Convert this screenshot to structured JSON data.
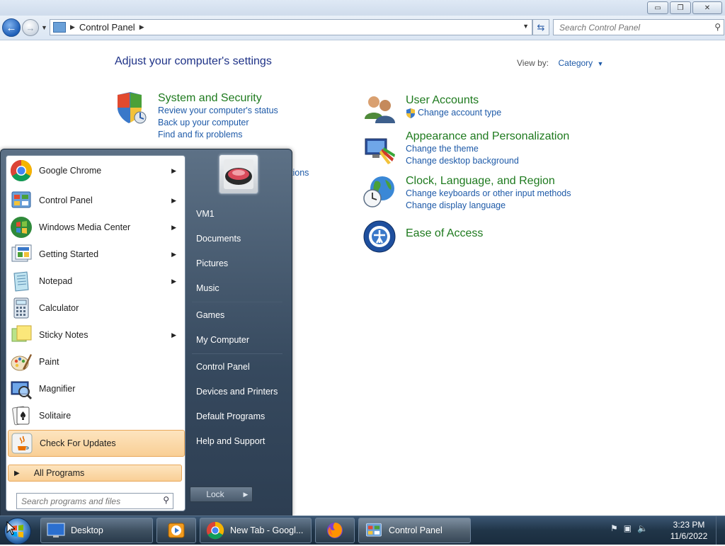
{
  "window": {
    "address": "Control Panel",
    "search_placeholder": "Search Control Panel",
    "minimize_label": "▭",
    "restore_label": "❐",
    "close_label": "✕"
  },
  "control_panel": {
    "heading": "Adjust your computer's settings",
    "view_by_label": "View by:",
    "view_by_value": "Category",
    "categories": [
      {
        "title": "System and Security",
        "links": [
          "Review your computer's status",
          "Back up your computer",
          "Find and fix problems"
        ]
      },
      {
        "title": "User Accounts",
        "links": [
          "Change account type"
        ]
      },
      {
        "title": "Appearance and Personalization",
        "links": [
          "Change the theme",
          "Change desktop background"
        ]
      },
      {
        "title": "Clock, Language, and Region",
        "links": [
          "Change keyboards or other input methods",
          "Change display language"
        ]
      },
      {
        "title": "Ease of Access",
        "links": []
      }
    ],
    "peek_text": "tions"
  },
  "start_menu": {
    "programs": [
      {
        "label": "Google Chrome",
        "icon": "chrome-icon",
        "has_submenu": true
      },
      {
        "label": "Control Panel",
        "icon": "control-panel-icon",
        "has_submenu": true
      },
      {
        "label": "Windows Media Center",
        "icon": "media-center-icon",
        "has_submenu": true
      },
      {
        "label": "Getting Started",
        "icon": "getting-started-icon",
        "has_submenu": true
      },
      {
        "label": "Notepad",
        "icon": "notepad-icon",
        "has_submenu": true
      },
      {
        "label": "Calculator",
        "icon": "calculator-icon",
        "has_submenu": false
      },
      {
        "label": "Sticky Notes",
        "icon": "sticky-notes-icon",
        "has_submenu": true
      },
      {
        "label": "Paint",
        "icon": "paint-icon",
        "has_submenu": false
      },
      {
        "label": "Magnifier",
        "icon": "magnifier-icon",
        "has_submenu": false
      },
      {
        "label": "Solitaire",
        "icon": "solitaire-icon",
        "has_submenu": false
      },
      {
        "label": "Check For Updates",
        "icon": "java-icon",
        "has_submenu": false
      }
    ],
    "all_programs": "All Programs",
    "search_placeholder": "Search programs and files",
    "right_items": [
      "VM1",
      "Documents",
      "Pictures",
      "Music",
      "Games",
      "My Computer",
      "Control Panel",
      "Devices and Printers",
      "Default Programs",
      "Help and Support"
    ],
    "lock_label": "Lock"
  },
  "taskbar": {
    "buttons": [
      {
        "label": "Desktop",
        "icon": "desktop-icon"
      },
      {
        "label": "",
        "icon": "media-player-icon"
      },
      {
        "label": "New Tab - Googl...",
        "icon": "chrome-icon"
      },
      {
        "label": "",
        "icon": "firefox-icon"
      },
      {
        "label": "Control Panel",
        "icon": "control-panel-icon"
      }
    ],
    "time": "3:23 PM",
    "date": "11/6/2022"
  }
}
